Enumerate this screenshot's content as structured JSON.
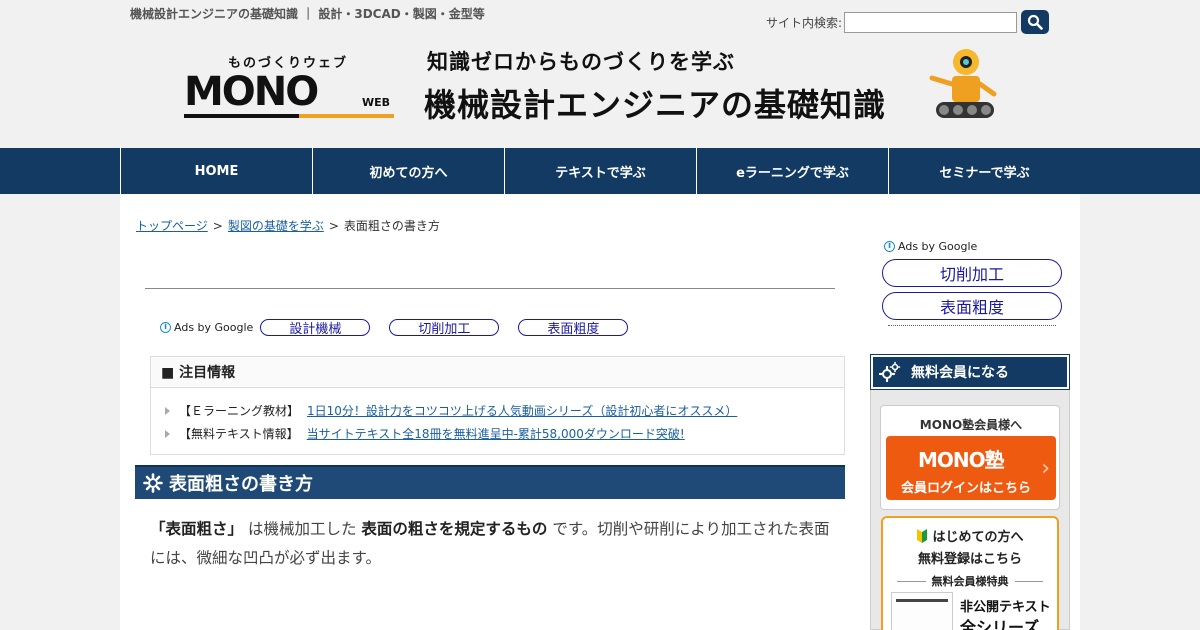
{
  "header": {
    "tagline": "機械設計エンジニアの基礎知識 ｜ 設計・3DCAD・製図・金型等",
    "search_label": "サイト内検索:",
    "search_value": "",
    "logo_kana": "ものづくりウェブ",
    "logo_word": "MONO",
    "logo_web": "WEB",
    "banner_sub": "知識ゼロからものづくりを学ぶ",
    "banner_title": "機械設計エンジニアの基礎知識"
  },
  "nav": {
    "items": [
      "HOME",
      "初めての方へ",
      "テキストで学ぶ",
      "eラーニングで学ぶ",
      "セミナーで学ぶ"
    ]
  },
  "breadcrumb": {
    "items": [
      "トップページ",
      "製図の基礎を学ぶ"
    ],
    "current": "表面粗さの書き方",
    "sep": ">"
  },
  "ads": {
    "label": "Ads by Google",
    "links": [
      "設計機械",
      "切削加工",
      "表面粗度"
    ]
  },
  "notice": {
    "heading": "■ 注目情報",
    "rows": [
      {
        "cat": "【Ｅラーニング教材】",
        "link": "1日10分！設計力をコツコツ上げる人気動画シリーズ（設計初心者にオススメ）"
      },
      {
        "cat": "【無料テキスト情報】",
        "link": "当サイトテキスト全18冊を無料進呈中-累計58,000ダウンロード突破!"
      }
    ]
  },
  "article": {
    "title": "表面粗さの書き方",
    "text_1": "「表面粗さ」",
    "text_2": "は機械加工した",
    "text_3": "表面の粗さを規定するもの",
    "text_4": "です。切削や研削により加工された表面には、微細な凹凸が必ず出ます。"
  },
  "sidebar": {
    "ads_label": "Ads by Google",
    "ad_links": [
      "切削加工",
      "表面粗度"
    ],
    "member_heading": "無料会員になる",
    "login_title": "MONO塾会員様へ",
    "login_logo": "MONO塾",
    "login_label": "会員ログインはこちら",
    "free_line1": "はじめての方へ",
    "free_line2": "無料登録はこちら",
    "free_line3": "無料会員様特典",
    "free_line4": "非公開テキスト",
    "free_line5": "全シリーズ"
  },
  "colors": {
    "navy": "#123a63",
    "section": "#1f4a78",
    "accent_orange": "#f0a020",
    "login_orange": "#ee5a10",
    "link": "#1a5f9e",
    "ad_link": "#1a1aa0"
  },
  "icons": [
    "search-icon",
    "gear-icon",
    "info-icon",
    "beginner-mark-icon",
    "robot-illustration"
  ]
}
